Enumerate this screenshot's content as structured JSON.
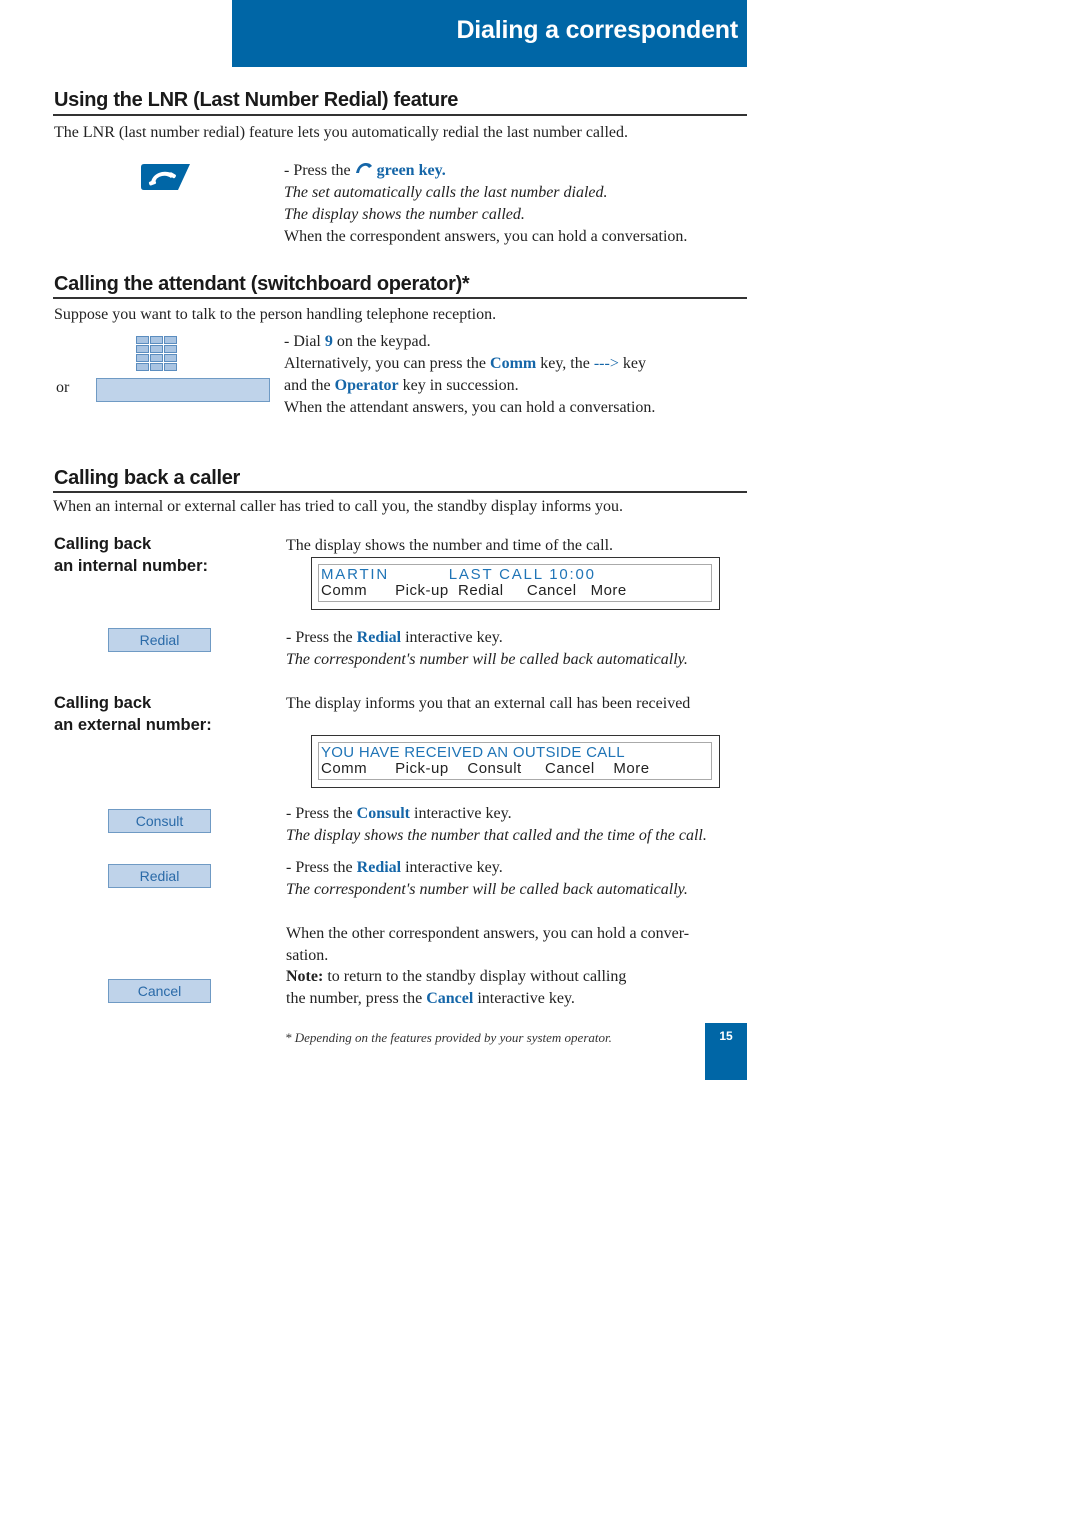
{
  "header": {
    "title": "Dialing a correspondent"
  },
  "lnr": {
    "title": "Using the LNR (Last Number Redial) feature",
    "intro": "The LNR (last number redial) feature lets you automatically redial the last number called.",
    "step_prefix": "- Press the",
    "step_key": "green key.",
    "line2": "The set automatically calls the last number dialed.",
    "line3": "The display shows the number called.",
    "line4": "When the correspondent answers, you can hold a conversation.",
    "icon": "phone-handset-icon"
  },
  "attendant": {
    "title": "Calling the attendant (switchboard operator)*",
    "intro": "Suppose you want to talk to the person handling telephone reception.",
    "or_label": "or",
    "dial_prefix": "- Dial",
    "dial_digit": "9",
    "dial_suffix": "on the keypad.",
    "alt_prefix": "Alternatively, you can press the",
    "alt_comm": "Comm",
    "alt_mid": "key, the",
    "alt_arrow": "--->",
    "alt_suffix": "key",
    "and_prefix": "and the",
    "and_operator": "Operator",
    "and_suffix": "key in succession.",
    "answer": "When the attendant answers, you can hold a conversation.",
    "icon": "keypad-icon"
  },
  "callback": {
    "title": "Calling back a caller",
    "intro": "When an internal or external caller has tried to call you, the standby display informs you.",
    "internal": {
      "label_line1": "Calling back",
      "label_line2": "an internal number:",
      "desc": "The display shows the number and time of the call.",
      "display_line1": "MARTIN          LAST CALL 10:00",
      "display_line2": "Comm      Pick-up  Redial     Cancel   More",
      "key_label": "Redial",
      "step_prefix": "- Press the",
      "step_key": "Redial",
      "step_suffix": "interactive key.",
      "step_note": "The correspondent's number will be called back automatically."
    },
    "external": {
      "label_line1": "Calling back",
      "label_line2": "an external number:",
      "desc": "The display informs you that an external call has been received",
      "display_line1": "YOU HAVE RECEIVED AN OUTSIDE CALL",
      "display_line2": "Comm      Pick-up    Consult     Cancel    More",
      "consult_key": "Consult",
      "consult_prefix": "- Press the",
      "consult_word": "Consult",
      "consult_suffix": "interactive key.",
      "consult_note": "The display shows the number that called and the time of the call.",
      "redial_key": "Redial",
      "redial_prefix": "- Press the",
      "redial_word": "Redial",
      "redial_suffix": "interactive key.",
      "redial_note": "The correspondent's number will be called back automatically.",
      "answer_line1": "When the other correspondent answers, you can hold a conver-",
      "answer_line2": "sation.",
      "note_label": "Note:",
      "note_text": "to return to the standby display without calling",
      "note_line2_prefix": "the number, press the",
      "note_cancel": "Cancel",
      "note_line2_suffix": "interactive key.",
      "cancel_key": "Cancel"
    }
  },
  "footer": {
    "footnote": "* Depending on the features provided by your system operator.",
    "page_number": "15"
  },
  "colors": {
    "brand_blue": "#0066a6",
    "key_fill": "#bfd3ea",
    "link_blue": "#1566a8"
  }
}
